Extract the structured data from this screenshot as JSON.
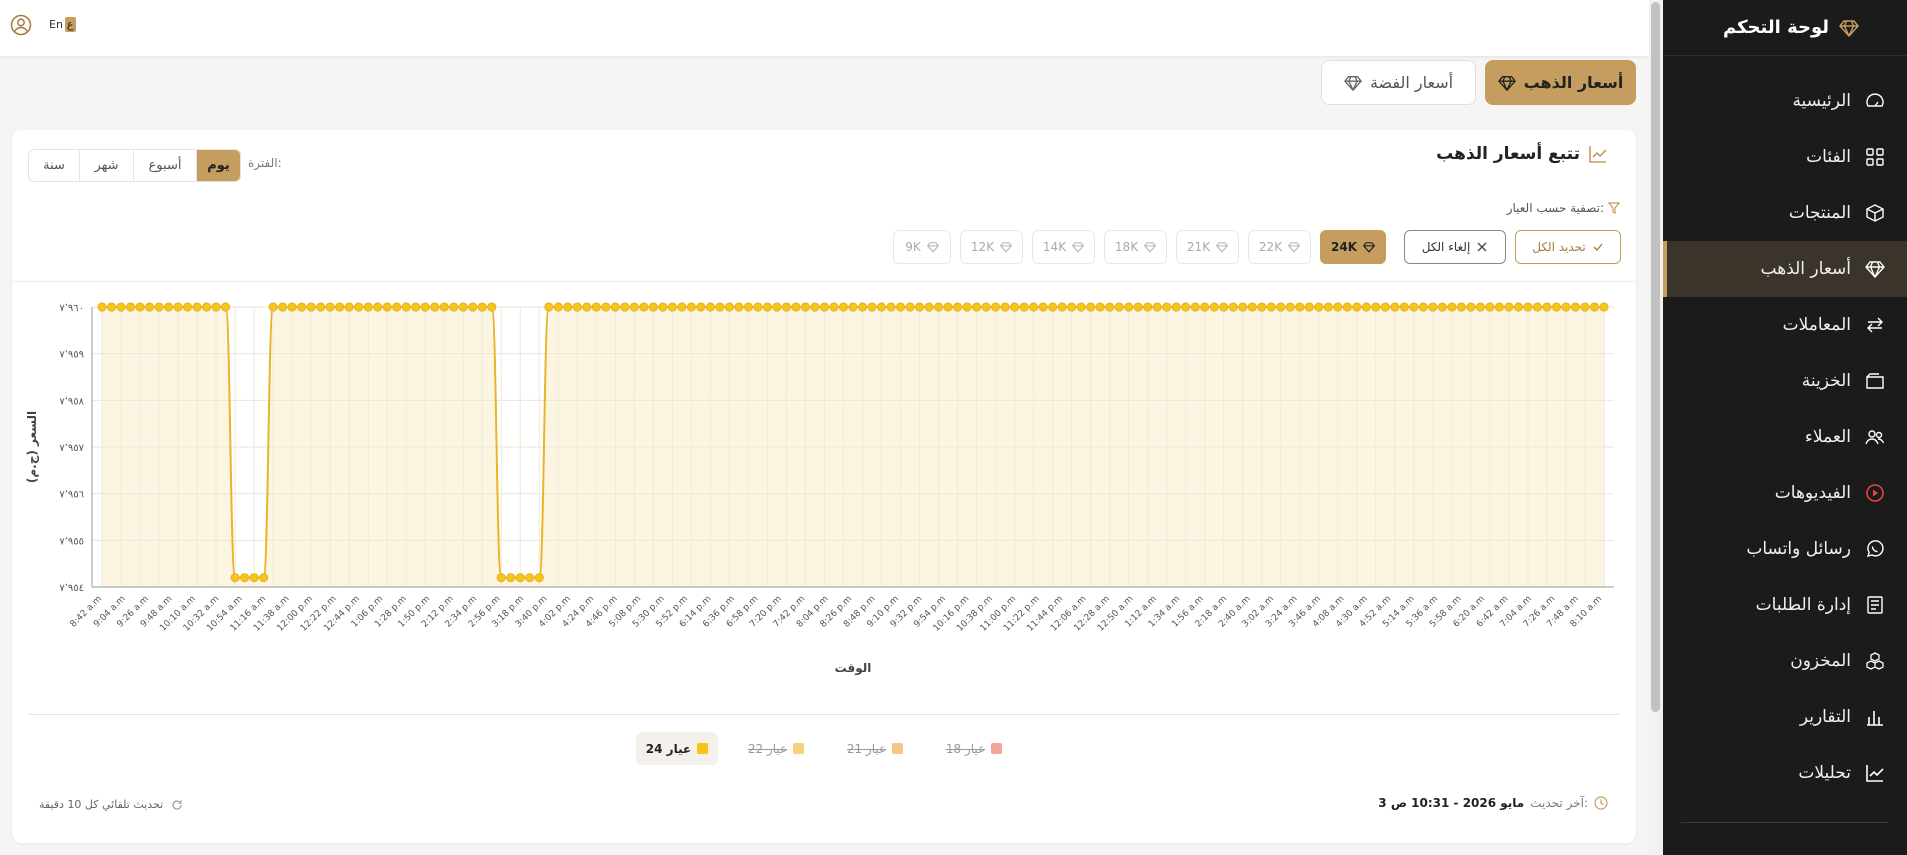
{
  "sidebar": {
    "title": "لوحة التحكم",
    "items": [
      {
        "label": "الرئيسية",
        "icon": "dashboard-icon"
      },
      {
        "label": "الفئات",
        "icon": "grid-icon"
      },
      {
        "label": "المنتجات",
        "icon": "box-icon"
      },
      {
        "label": "أسعار الذهب",
        "icon": "diamond-icon",
        "active": true
      },
      {
        "label": "المعاملات",
        "icon": "exchange-icon"
      },
      {
        "label": "الخزينة",
        "icon": "wallet-icon"
      },
      {
        "label": "العملاء",
        "icon": "users-icon"
      },
      {
        "label": "الفيديوهات",
        "icon": "play-icon"
      },
      {
        "label": "رسائل واتساب",
        "icon": "whatsapp-icon"
      },
      {
        "label": "إدارة الطلبات",
        "icon": "orders-icon"
      },
      {
        "label": "المخزون",
        "icon": "inventory-icon"
      },
      {
        "label": "التقارير",
        "icon": "bar-chart-icon"
      },
      {
        "label": "تحليلات",
        "icon": "trend-icon"
      }
    ]
  },
  "topbar": {
    "lang_en": "En",
    "lang_ar": "ع"
  },
  "tabs": {
    "gold": "أسعار الذهب",
    "silver": "أسعار الفضة"
  },
  "card": {
    "title": "تتبع أسعار الذهب",
    "period_label": "الفترة:",
    "periods": [
      "يوم",
      "أسبوع",
      "شهر",
      "سنة"
    ],
    "filter_label": "تصفية حسب العيار:",
    "select_all": "تحديد الكل",
    "clear_all": "إلغاء الكل",
    "karats": [
      "24K",
      "22K",
      "21K",
      "18K",
      "14K",
      "12K",
      "9K"
    ],
    "legend": [
      "عيار 24",
      "عيار 22",
      "عيار 21",
      "عيار 18"
    ],
    "last_update_label": "آخر تحديث:",
    "last_update_value": "3 مايو 2026 - 10:31 ص",
    "auto_refresh": "تحديث تلقائي كل 10 دقيقة"
  },
  "colors": {
    "accent": "#c59d5f",
    "line": "#e8b52a",
    "k22": "#f5d27a",
    "k21": "#f5c68a",
    "k18": "#f2a59a"
  },
  "chart_data": {
    "type": "line",
    "xlabel": "الوقت",
    "ylabel": "السعر (ج.م)",
    "ylim": [
      7954,
      7960
    ],
    "yticks": [
      "٧٬٩٥٤",
      "٧٬٩٥٥",
      "٧٬٩٥٦",
      "٧٬٩٥٧",
      "٧٬٩٥٨",
      "٧٬٩٥٩",
      "٧٬٩٦٠"
    ],
    "xticks": [
      "8:42 a.m",
      "9:04 a.m",
      "9:26 a.m",
      "9:48 a.m",
      "10:10 a.m",
      "10:32 a.m",
      "10:54 a.m",
      "11:16 a.m",
      "11:38 a.m",
      "12:00 p.m",
      "12:22 p.m",
      "12:44 p.m",
      "1:06 p.m",
      "1:28 p.m",
      "1:50 p.m",
      "2:12 p.m",
      "2:34 p.m",
      "2:56 p.m",
      "3:18 p.m",
      "3:40 p.m",
      "4:02 p.m",
      "4:24 p.m",
      "4:46 p.m",
      "5:08 p.m",
      "5:30 p.m",
      "5:52 p.m",
      "6:14 p.m",
      "6:36 p.m",
      "6:58 p.m",
      "7:20 p.m",
      "7:42 p.m",
      "8:04 p.m",
      "8:26 p.m",
      "8:48 p.m",
      "9:10 p.m",
      "9:32 p.m",
      "9:54 p.m",
      "10:16 p.m",
      "10:38 p.m",
      "11:00 p.m",
      "11:22 p.m",
      "11:44 p.m",
      "12:06 a.m",
      "12:28 a.m",
      "12:50 a.m",
      "1:12 a.m",
      "1:34 a.m",
      "1:56 a.m",
      "2:18 a.m",
      "2:40 a.m",
      "3:02 a.m",
      "3:24 a.m",
      "3:46 a.m",
      "4:08 a.m",
      "4:30 a.m",
      "4:52 a.m",
      "5:14 a.m",
      "5:36 a.m",
      "5:58 a.m",
      "6:20 a.m",
      "6:42 a.m",
      "7:04 a.m",
      "7:26 a.m",
      "7:48 a.m",
      "8:10 a.m"
    ],
    "series": [
      {
        "name": "عيار 24",
        "values": [
          7960,
          7960,
          7960,
          7960,
          7960,
          7960,
          7960,
          7960,
          7960,
          7960,
          7960,
          7960,
          7960,
          7960,
          7954.2,
          7954.2,
          7954.2,
          7954.2,
          7960,
          7960,
          7960,
          7960,
          7960,
          7960,
          7960,
          7960,
          7960,
          7960,
          7960,
          7960,
          7960,
          7960,
          7960,
          7960,
          7960,
          7960,
          7960,
          7960,
          7960,
          7960,
          7960,
          7960,
          7954.2,
          7954.2,
          7954.2,
          7954.2,
          7954.2,
          7960,
          7960,
          7960,
          7960,
          7960,
          7960,
          7960,
          7960,
          7960,
          7960,
          7960,
          7960,
          7960,
          7960,
          7960,
          7960,
          7960,
          7960,
          7960,
          7960,
          7960,
          7960,
          7960,
          7960,
          7960,
          7960,
          7960,
          7960,
          7960,
          7960,
          7960,
          7960,
          7960,
          7960,
          7960,
          7960,
          7960,
          7960,
          7960,
          7960,
          7960,
          7960,
          7960,
          7960,
          7960,
          7960,
          7960,
          7960,
          7960,
          7960,
          7960,
          7960,
          7960,
          7960,
          7960,
          7960,
          7960,
          7960,
          7960,
          7960,
          7960,
          7960,
          7960,
          7960,
          7960,
          7960,
          7960,
          7960,
          7960,
          7960,
          7960,
          7960,
          7960,
          7960,
          7960,
          7960,
          7960,
          7960,
          7960,
          7960,
          7960,
          7960,
          7960,
          7960,
          7960,
          7960,
          7960,
          7960,
          7960,
          7960,
          7960,
          7960,
          7960,
          7960,
          7960,
          7960,
          7960,
          7960,
          7960,
          7960,
          7960,
          7960,
          7960,
          7960,
          7960,
          7960,
          7960,
          7960,
          7960,
          7960,
          7960,
          7960
        ]
      }
    ]
  }
}
